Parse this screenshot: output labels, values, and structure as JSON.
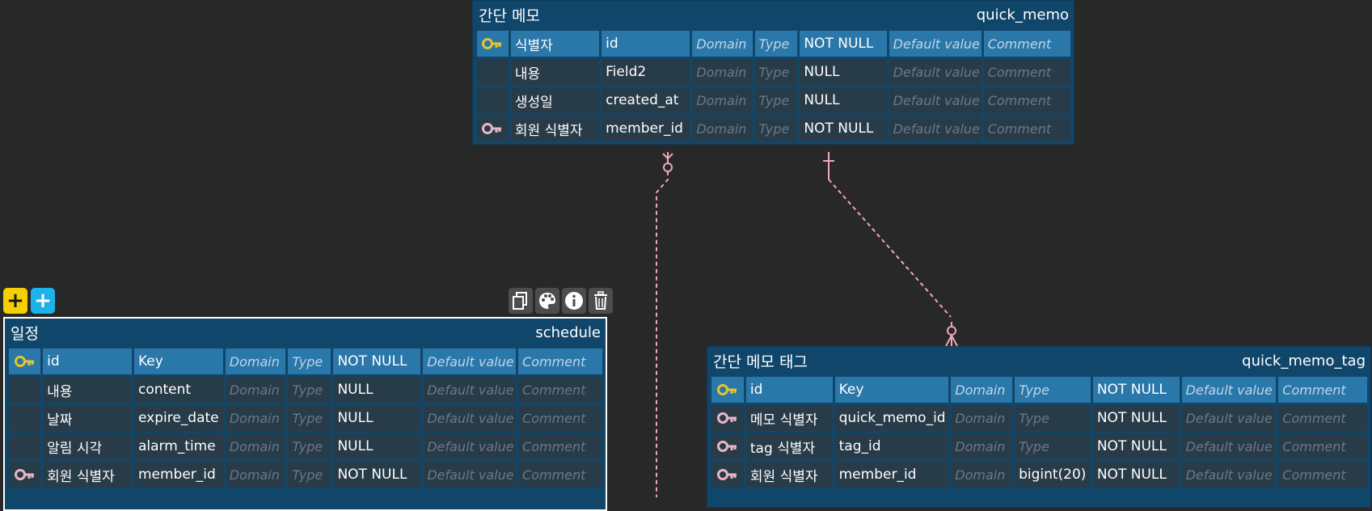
{
  "colors": {
    "canvas": "#282828",
    "table_header": "#11466b",
    "pk_row": "#2a77aa",
    "row": "#283b48",
    "pk_key_icon": "#e6c52c",
    "fk_key_icon": "#e8b7c4",
    "relation_line": "#f0a7b6",
    "add_yellow": "#f5d000",
    "add_blue": "#1eb2ea"
  },
  "placeholders": {
    "domain": "Domain",
    "type": "Type",
    "default": "Default value",
    "comment": "Comment"
  },
  "tables": {
    "quick_memo": {
      "logical": "간단 메모",
      "physical": "quick_memo",
      "columns": [
        {
          "key": "pk",
          "logical": "식별자",
          "physical": "id",
          "type": "",
          "null": "NOT NULL"
        },
        {
          "key": "",
          "logical": "내용",
          "physical": "Field2",
          "type": "",
          "null": "NULL"
        },
        {
          "key": "",
          "logical": "생성일",
          "physical": "created_at",
          "type": "",
          "null": "NULL"
        },
        {
          "key": "fk",
          "logical": "회원 식별자",
          "physical": "member_id",
          "type": "",
          "null": "NOT NULL"
        }
      ]
    },
    "schedule": {
      "logical": "일정",
      "physical": "schedule",
      "columns": [
        {
          "key": "pk",
          "logical": "id",
          "physical": "Key",
          "type": "",
          "null": "NOT NULL"
        },
        {
          "key": "",
          "logical": "내용",
          "physical": "content",
          "type": "",
          "null": "NULL"
        },
        {
          "key": "",
          "logical": "날짜",
          "physical": "expire_date",
          "type": "",
          "null": "NULL"
        },
        {
          "key": "",
          "logical": "알림 시각",
          "physical": "alarm_time",
          "type": "",
          "null": "NULL"
        },
        {
          "key": "fk",
          "logical": "회원 식별자",
          "physical": "member_id",
          "type": "",
          "null": "NOT NULL"
        }
      ]
    },
    "quick_memo_tag": {
      "logical": "간단 메모 태그",
      "physical": "quick_memo_tag",
      "columns": [
        {
          "key": "pk",
          "logical": "id",
          "physical": "Key",
          "type": "",
          "null": "NOT NULL"
        },
        {
          "key": "fk",
          "logical": "메모 식별자",
          "physical": "quick_memo_id",
          "type": "",
          "null": "NOT NULL"
        },
        {
          "key": "fk",
          "logical": "tag 식별자",
          "physical": "tag_id",
          "type": "",
          "null": "NOT NULL"
        },
        {
          "key": "fk",
          "logical": "회원 식별자",
          "physical": "member_id",
          "type": "bigint(20)",
          "null": "NOT NULL"
        }
      ]
    }
  },
  "toolbar": {
    "add_yellow_label": "+",
    "add_blue_label": "+",
    "tools": [
      "copy-icon",
      "palette-icon",
      "info-icon",
      "trash-icon"
    ]
  }
}
